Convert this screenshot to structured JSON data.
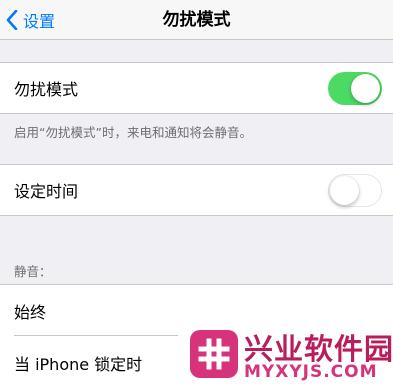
{
  "navbar": {
    "back_label": "设置",
    "title": "勿扰模式"
  },
  "dnd": {
    "label": "勿扰模式",
    "enabled": true,
    "footer": "启用“勿扰模式”时，来电和通知将会静音。"
  },
  "scheduled": {
    "label": "设定时间",
    "enabled": false
  },
  "silence": {
    "header": "静音：",
    "options": [
      {
        "label": "始终"
      },
      {
        "label": "当 iPhone 锁定时"
      }
    ]
  },
  "watermark": {
    "title": "兴业软件园",
    "url": "MYXYJS.COM"
  },
  "colors": {
    "accent": "#007aff",
    "toggle_on": "#4cd964",
    "background": "#efeff4",
    "watermark": "#d6337a"
  },
  "icons": {
    "back": "chevron-left-icon",
    "logo": "hash-logo-icon"
  }
}
